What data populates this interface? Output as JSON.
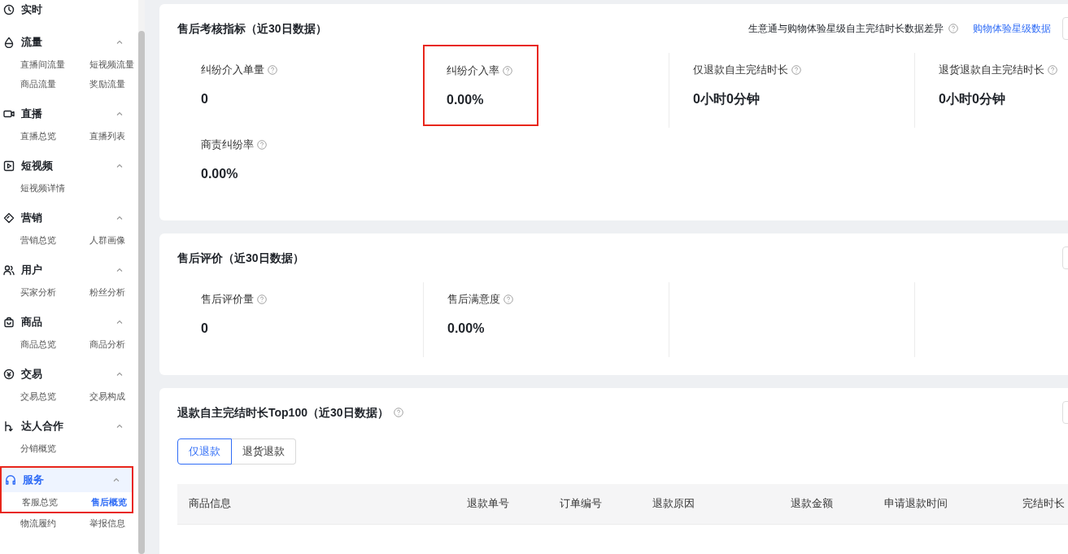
{
  "sidebar": {
    "items": [
      {
        "kind": "link",
        "title": "实时",
        "selected": false,
        "annotated": false
      },
      {
        "kind": "group",
        "title": "流量",
        "expanded": true,
        "selected": false,
        "annotated": false,
        "children": [
          {
            "label": "直播间流量",
            "selected": false
          },
          {
            "label": "短视频流量",
            "selected": false
          },
          {
            "label": "商品流量",
            "selected": false
          },
          {
            "label": "奖励流量",
            "selected": false
          }
        ]
      },
      {
        "kind": "group",
        "title": "直播",
        "expanded": true,
        "selected": false,
        "annotated": false,
        "children": [
          {
            "label": "直播总览",
            "selected": false
          },
          {
            "label": "直播列表",
            "selected": false
          }
        ]
      },
      {
        "kind": "group",
        "title": "短视频",
        "expanded": true,
        "selected": false,
        "annotated": false,
        "children": [
          {
            "label": "短视频详情",
            "selected": false
          }
        ]
      },
      {
        "kind": "group",
        "title": "营销",
        "expanded": true,
        "selected": false,
        "annotated": false,
        "children": [
          {
            "label": "营销总览",
            "selected": false
          },
          {
            "label": "人群画像",
            "selected": false
          }
        ]
      },
      {
        "kind": "group",
        "title": "用户",
        "expanded": true,
        "selected": false,
        "annotated": false,
        "children": [
          {
            "label": "买家分析",
            "selected": false
          },
          {
            "label": "粉丝分析",
            "selected": false
          }
        ]
      },
      {
        "kind": "group",
        "title": "商品",
        "expanded": true,
        "selected": false,
        "annotated": false,
        "children": [
          {
            "label": "商品总览",
            "selected": false
          },
          {
            "label": "商品分析",
            "selected": false
          }
        ]
      },
      {
        "kind": "group",
        "title": "交易",
        "expanded": true,
        "selected": false,
        "annotated": false,
        "children": [
          {
            "label": "交易总览",
            "selected": false
          },
          {
            "label": "交易构成",
            "selected": false
          }
        ]
      },
      {
        "kind": "group",
        "title": "达人合作",
        "expanded": true,
        "selected": false,
        "annotated": false,
        "children": [
          {
            "label": "分销概览",
            "selected": false
          }
        ]
      },
      {
        "kind": "group",
        "title": "服务",
        "expanded": true,
        "selected": true,
        "annotated": true,
        "children": [
          {
            "label": "客服总览",
            "selected": false
          },
          {
            "label": "售后概览",
            "selected": true
          },
          {
            "label": "物流履约",
            "selected": false
          },
          {
            "label": "举报信息",
            "selected": false
          }
        ]
      }
    ]
  },
  "cards": [
    {
      "kind": "metrics",
      "title": "售后考核指标（近30日数据）",
      "note": "生意通与购物体验星级自主完结时长数据差异",
      "link": "购物体验星级数据",
      "metrics": [
        {
          "label": "纠纷介入单量",
          "value": "0",
          "annotated": false
        },
        {
          "label": "纠纷介入率",
          "value": "0.00%",
          "annotated": true
        },
        {
          "label": "仅退款自主完结时长",
          "value": "0小时0分钟",
          "annotated": false
        },
        {
          "label": "退货退款自主完结时长",
          "value": "0小时0分钟",
          "annotated": false
        },
        {
          "label": "商责纠纷率",
          "value": "0.00%",
          "annotated": false
        }
      ]
    },
    {
      "kind": "metrics",
      "title": "售后评价（近30日数据）",
      "metrics": [
        {
          "label": "售后评价量",
          "value": "0",
          "annotated": false
        },
        {
          "label": "售后满意度",
          "value": "0.00%",
          "annotated": false
        }
      ]
    },
    {
      "kind": "table",
      "title": "退款自主完结时长Top100（近30日数据）",
      "title_help": true,
      "tabs": [
        {
          "label": "仅退款",
          "selected": true
        },
        {
          "label": "退货退款",
          "selected": false
        }
      ],
      "table": {
        "columns": [
          "商品信息",
          "退款单号",
          "订单编号",
          "退款原因",
          "退款金额",
          "申请退款时间",
          "完结时长"
        ]
      }
    }
  ]
}
